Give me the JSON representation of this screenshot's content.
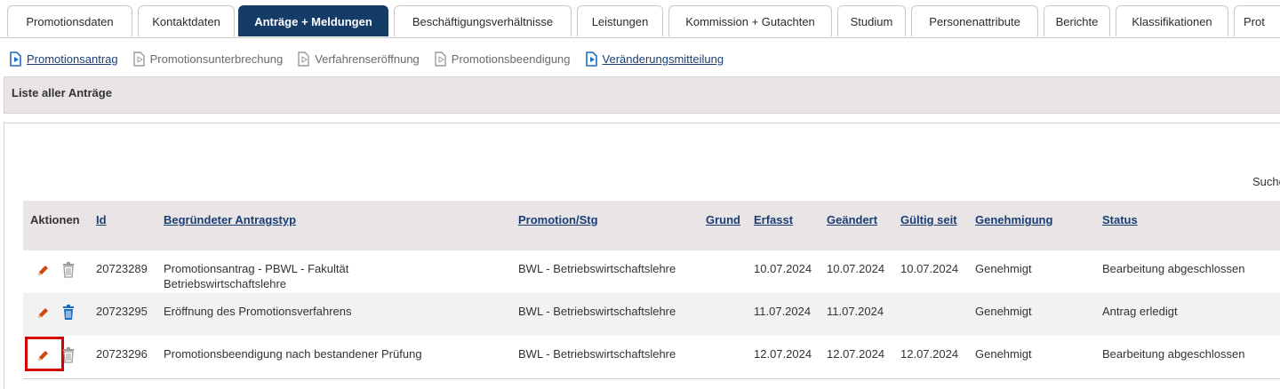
{
  "tabs": [
    {
      "label": "Promotionsdaten",
      "active": false
    },
    {
      "label": "Kontaktdaten",
      "active": false
    },
    {
      "label": "Anträge + Meldungen",
      "active": true
    },
    {
      "label": "Beschäftigungsverhältnisse",
      "active": false
    },
    {
      "label": "Leistungen",
      "active": false
    },
    {
      "label": "Kommission + Gutachten",
      "active": false
    },
    {
      "label": "Studium",
      "active": false
    },
    {
      "label": "Personenattribute",
      "active": false
    },
    {
      "label": "Berichte",
      "active": false
    },
    {
      "label": "Klassifikationen",
      "active": false
    },
    {
      "label": "Prot",
      "active": false
    }
  ],
  "action_links": [
    {
      "label": "Promotionsantrag",
      "enabled": true
    },
    {
      "label": "Promotionsunterbrechung",
      "enabled": false
    },
    {
      "label": "Verfahrenseröffnung",
      "enabled": false
    },
    {
      "label": "Promotionsbeendigung",
      "enabled": false
    },
    {
      "label": "Veränderungsmitteilung",
      "enabled": true
    }
  ],
  "section": {
    "title": "Liste aller Anträge",
    "search_label": "Suche"
  },
  "table": {
    "headers": {
      "actions": "Aktionen",
      "id": "Id",
      "type": "Begründeter Antragstyp",
      "promotion": "Promotion/Stg",
      "reason": "Grund",
      "created": "Erfasst",
      "changed": "Geändert",
      "valid_since": "Gültig seit",
      "approval": "Genehmigung",
      "status": "Status"
    },
    "rows": [
      {
        "id": "20723289",
        "type": "Promotionsantrag - PBWL - Fakultät Betriebswirtschaftslehre",
        "promotion": "BWL - Betriebswirtschaftslehre",
        "reason": "",
        "created": "10.07.2024",
        "changed": "10.07.2024",
        "valid_since": "10.07.2024",
        "approval": "Genehmigt",
        "status": "Bearbeitung abgeschlossen",
        "delete_enabled": false,
        "highlighted": false
      },
      {
        "id": "20723295",
        "type": "Eröffnung des Promotionsverfahrens",
        "promotion": "BWL - Betriebswirtschaftslehre",
        "reason": "",
        "created": "11.07.2024",
        "changed": "11.07.2024",
        "valid_since": "",
        "approval": "Genehmigt",
        "status": "Antrag erledigt",
        "delete_enabled": true,
        "highlighted": false
      },
      {
        "id": "20723296",
        "type": "Promotionsbeendigung nach bestandener Prüfung",
        "promotion": "BWL - Betriebswirtschaftslehre",
        "reason": "",
        "created": "12.07.2024",
        "changed": "12.07.2024",
        "valid_since": "12.07.2024",
        "approval": "Genehmigt",
        "status": "Bearbeitung abgeschlossen",
        "delete_enabled": false,
        "highlighted": true
      }
    ]
  },
  "colors": {
    "active_tab": "#153c66",
    "link": "#1a3e74",
    "header_bg": "#e9e5e6",
    "edit_icon": "#d04a10",
    "delete_icon_enabled": "#1a6fc4",
    "delete_icon_disabled": "#9a9a9a",
    "highlight_border": "#d40000"
  }
}
